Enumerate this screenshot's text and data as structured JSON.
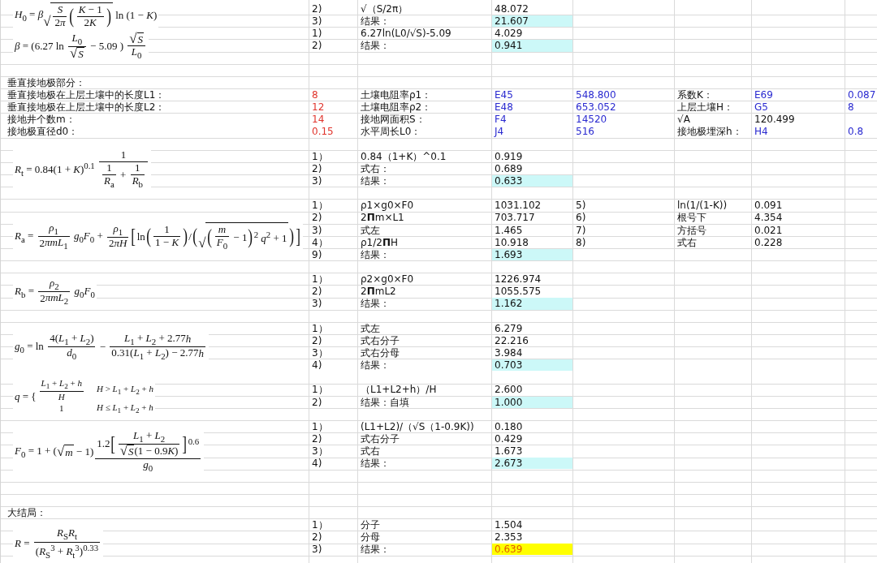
{
  "sheet": [
    {
      "formula": [
        "*H*$_{0}$ = *β*",
        {
          "root": "√",
          "body": [
            {
              "frac": [
                "*S*",
                [
                  "2",
                  "*π*"
                ]
              ]
            },
            {
              "big": "("
            },
            {
              "frac": [
                "*K* − 1",
                [
                  "2",
                  "*K*"
                ]
              ]
            },
            {
              "big": ")"
            }
          ]
        },
        " ln (1 − *K*)"
      ],
      "rows": [
        {
          "cells": [
            {},
            {
              "text": "2)"
            },
            {
              "text": "√（S/2π）"
            },
            {
              "text": "48.072"
            }
          ]
        },
        {
          "cells": [
            {},
            {
              "text": "3)"
            },
            {
              "text": "结果："
            },
            {
              "text": "21.607",
              "kind": "result"
            }
          ]
        }
      ]
    },
    {
      "formula": [
        "*β* = (6.27 ln ",
        {
          "frac": [
            "*L*$_{0}$",
            [
              {
                "root": "√",
                "body": "*S*"
              }
            ]
          ]
        },
        " − 5.09 ) ",
        {
          "frac": [
            [
              {
                "root": "√",
                "body": "*S*"
              }
            ],
            "*L*$_{0}$"
          ]
        }
      ],
      "rows": [
        {
          "cells": [
            {},
            {
              "text": "1)"
            },
            {
              "text": "6.27ln(L0/√S)-5.09"
            },
            {
              "text": "4.029"
            }
          ]
        },
        {
          "cells": [
            {},
            {
              "text": "2)"
            },
            {
              "text": "结果："
            },
            {
              "text": "0.941",
              "kind": "result"
            }
          ]
        },
        {}
      ]
    },
    {
      "rows": [
        {},
        {
          "cells": [
            {
              "text": "垂直接地极部分："
            }
          ]
        },
        {
          "cells": [
            {
              "text": "垂直接地极在上层土壤中的长度L1："
            },
            {
              "text": "8",
              "color": "#e0342c"
            },
            {
              "text": "土壤电阻率ρ1："
            },
            {
              "text": "E45",
              "color": "#2a2ad0"
            },
            {
              "text": "548.800",
              "color": "#2a2ad0"
            },
            {
              "text": "系数K："
            },
            {
              "text": "E69",
              "color": "#2a2ad0"
            },
            {
              "text": "0.087",
              "color": "#2a2ad0"
            }
          ]
        },
        {
          "cells": [
            {
              "text": "垂直接地极在上层土壤中的长度L2："
            },
            {
              "text": "12",
              "color": "#e0342c"
            },
            {
              "text": "土壤电阻率ρ2："
            },
            {
              "text": "E48",
              "color": "#2a2ad0"
            },
            {
              "text": "653.052",
              "color": "#2a2ad0"
            },
            {
              "text": "上层土壤H："
            },
            {
              "text": "G5",
              "color": "#2a2ad0"
            },
            {
              "text": "8",
              "color": "#2a2ad0"
            }
          ]
        },
        {
          "cells": [
            {
              "text": "接地井个数m："
            },
            {
              "text": "14",
              "color": "#e0342c"
            },
            {
              "text": "接地网面积S："
            },
            {
              "text": "F4",
              "color": "#2a2ad0"
            },
            {
              "text": "14520",
              "color": "#2a2ad0"
            },
            {
              "text": "√A"
            },
            {
              "text": "120.499"
            }
          ]
        },
        {
          "cells": [
            {
              "text": "接地极直径d0："
            },
            {
              "text": "0.15",
              "color": "#e0342c"
            },
            {
              "text": "水平周长L0："
            },
            {
              "text": "J4",
              "color": "#2a2ad0"
            },
            {
              "text": "516",
              "color": "#2a2ad0"
            },
            {
              "text": "接地极埋深h："
            },
            {
              "text": "H4",
              "color": "#2a2ad0"
            },
            {
              "text": "0.8",
              "color": "#2a2ad0"
            }
          ]
        }
      ]
    },
    {
      "formula": [
        "*R*$_{t}$ = 0.84(1 + *K*)$^{0.1}$ ",
        {
          "frac": [
            "1",
            [
              {
                "frac": [
                  "1",
                  "*R*$_{a}$"
                ]
              },
              " + ",
              {
                "frac": [
                  "1",
                  "*R*$_{b}$"
                ]
              }
            ]
          ]
        }
      ],
      "rows": [
        {},
        {
          "cells": [
            {},
            {
              "text": "1）"
            },
            {
              "text": "0.84（1+K）^0.1"
            },
            {
              "text": "0.919"
            }
          ]
        },
        {
          "cells": [
            {},
            {
              "text": "2)"
            },
            {
              "text": "式右："
            },
            {
              "text": "0.689"
            }
          ]
        },
        {
          "cells": [
            {},
            {
              "text": "3)"
            },
            {
              "text": "结果："
            },
            {
              "text": "0.633",
              "kind": "result"
            }
          ]
        },
        {}
      ]
    },
    {
      "formula": [
        "*R*$_{a}$ = ",
        {
          "frac": [
            "*ρ*$_{1}$",
            [
              "2",
              "*πmL*$_{1}$"
            ]
          ]
        },
        " *g*$_{0}$*F*$_{0}$ + ",
        {
          "frac": [
            "*ρ*$_{1}$",
            [
              "2",
              "*πH*"
            ]
          ]
        },
        {
          "big": "["
        },
        "ln",
        {
          "big": "("
        },
        {
          "frac": [
            "1",
            "1 − *K*"
          ]
        },
        {
          "big": ")"
        },
        "/",
        {
          "big": "("
        },
        {
          "root": "√",
          "body": [
            {
              "big": "("
            },
            {
              "frac": [
                "*m*",
                "*F*$_{0}$"
              ]
            },
            " − 1",
            {
              "big": ")"
            },
            "$^{2}$ *q*$^{2}$ + 1"
          ]
        },
        {
          "big": ")"
        },
        {
          "big": "]"
        }
      ],
      "rows": [
        {
          "cells": [
            {},
            {
              "text": "1）"
            },
            {
              "text": "ρ1×g0×F0"
            },
            {
              "text": "1031.102"
            },
            {
              "text": "5)"
            },
            {
              "text": "ln(1/(1-K))"
            },
            {
              "text": "0.091"
            }
          ]
        },
        {
          "cells": [
            {},
            {
              "text": "2)"
            },
            {
              "text": "2**Π**m×L1"
            },
            {
              "text": "703.717"
            },
            {
              "text": "6)"
            },
            {
              "text": "根号下"
            },
            {
              "text": "4.354"
            }
          ]
        },
        {
          "cells": [
            {},
            {
              "text": "3)"
            },
            {
              "text": "式左"
            },
            {
              "text": "1.465"
            },
            {
              "text": "7)"
            },
            {
              "text": "方括号"
            },
            {
              "text": "0.021"
            }
          ]
        },
        {
          "cells": [
            {},
            {
              "text": "4）"
            },
            {
              "text": "ρ1/2**Π**H"
            },
            {
              "text": "10.918"
            },
            {
              "text": "8)"
            },
            {
              "text": "式右"
            },
            {
              "text": "0.228"
            }
          ]
        },
        {
          "cells": [
            {},
            {
              "text": "9)"
            },
            {
              "text": "结果："
            },
            {
              "text": "1.693",
              "kind": "result"
            }
          ]
        },
        {}
      ]
    },
    {
      "formula": [
        "*R*$_{b}$ = ",
        {
          "frac": [
            "*ρ*$_{2}$",
            [
              "2",
              "*πmL*$_{2}$"
            ]
          ]
        },
        " *g*$_{0}$*F*$_{0}$"
      ],
      "rows": [
        {
          "cells": [
            {},
            {
              "text": "1）"
            },
            {
              "text": "ρ2×g0×F0"
            },
            {
              "text": "1226.974"
            }
          ]
        },
        {
          "cells": [
            {},
            {
              "text": "2)"
            },
            {
              "text": "2**Π**mL2"
            },
            {
              "text": "1055.575"
            }
          ]
        },
        {
          "cells": [
            {},
            {
              "text": "3)"
            },
            {
              "text": "结果："
            },
            {
              "text": "1.162",
              "kind": "result"
            }
          ]
        }
      ]
    },
    {
      "rows": [
        {}
      ]
    },
    {
      "formula": [
        "*g*$_{0}$ = ln ",
        {
          "frac": [
            "4(*L*$_{1}$ + *L*$_{2}$)",
            "*d*$_{0}$"
          ]
        },
        " − ",
        {
          "frac": [
            [
              "*L*$_{1}$ + *L*$_{2}$ + 2.77",
              "*h*"
            ],
            [
              "0.31(*L*$_{1}$ + *L*$_{2}$) − 2.77",
              "*h*"
            ]
          ]
        }
      ],
      "rows": [
        {
          "cells": [
            {},
            {
              "text": "1）"
            },
            {
              "text": "式左"
            },
            {
              "text": "6.279"
            }
          ]
        },
        {
          "cells": [
            {},
            {
              "text": "2)"
            },
            {
              "text": "式右分子"
            },
            {
              "text": "22.216"
            }
          ]
        },
        {
          "cells": [
            {},
            {
              "text": "3）"
            },
            {
              "text": "式右分母"
            },
            {
              "text": "3.984"
            }
          ]
        },
        {
          "cells": [
            {},
            {
              "text": "4)"
            },
            {
              "text": "结果："
            },
            {
              "text": "0.703",
              "kind": "result"
            }
          ]
        }
      ]
    },
    {
      "formula": [
        "*q* = {",
        {
          "cases": [
            [
              [
                {
                  "frac": [
                    "*L*$_{1}$ + *L*$_{2}$ + *h*",
                    "*H*"
                  ]
                }
              ],
              "*H* > *L*$_{1}$ + *L*$_{2}$ + *h*"
            ],
            [
              "1",
              "*H* ≤ *L*$_{1}$ + *L*$_{2}$ + *h*"
            ]
          ]
        }
      ],
      "rows": [
        {},
        {
          "cells": [
            {},
            {
              "text": "1）"
            },
            {
              "text": "（L1+L2+h）/H"
            },
            {
              "text": "2.600"
            }
          ]
        },
        {
          "cells": [
            {},
            {
              "text": "2)"
            },
            {
              "text": "结果：自填"
            },
            {
              "text": "1.000",
              "kind": "result"
            }
          ]
        },
        {}
      ]
    },
    {
      "formula": [
        "*F*$_{0}$ = 1 + (",
        {
          "root": "√",
          "body": "*m*"
        },
        " − 1)",
        {
          "frac": [
            [
              "1.2",
              {
                "big": "["
              },
              {
                "frac": [
                  "*L*$_{1}$ + *L*$_{2}$",
                  [
                    {
                      "root": "√",
                      "body": "*S*"
                    },
                    "(1 − 0.9",
                    "*K*",
                    ")"
                  ]
                ]
              },
              {
                "big": "]"
              },
              "$^{0.6}$"
            ],
            "*g*$_{0}$"
          ]
        }
      ],
      "rows": [
        {
          "cells": [
            {},
            {
              "text": "1）"
            },
            {
              "text": "(L1+L2)/（√S（1-0.9K))"
            },
            {
              "text": "0.180"
            }
          ]
        },
        {
          "cells": [
            {},
            {
              "text": "2)"
            },
            {
              "text": "式右分子"
            },
            {
              "text": "0.429"
            }
          ]
        },
        {
          "cells": [
            {},
            {
              "text": "3）"
            },
            {
              "text": "式右"
            },
            {
              "text": "1.673"
            }
          ]
        },
        {
          "cells": [
            {},
            {
              "text": "4)"
            },
            {
              "text": "结果："
            },
            {
              "text": "2.673",
              "kind": "result"
            }
          ]
        },
        {}
      ]
    },
    {
      "rows": [
        {},
        {},
        {
          "cells": [
            {
              "text": "大结局："
            }
          ]
        }
      ]
    },
    {
      "formula": [
        "*R* = ",
        {
          "frac": [
            "*R*$_{S}$*R*$_{t}$",
            "(*R*$_{S}$$^{3}$ + *R*$_{t}$$^{3}$)$^{0.33}$"
          ]
        }
      ],
      "rows": [
        {
          "cells": [
            {},
            {
              "text": "1）"
            },
            {
              "text": "分子"
            },
            {
              "text": "1.504"
            }
          ]
        },
        {
          "cells": [
            {},
            {
              "text": "2)"
            },
            {
              "text": "分母"
            },
            {
              "text": "2.353"
            }
          ]
        },
        {
          "cells": [
            {},
            {
              "text": "3)"
            },
            {
              "text": "结果："
            },
            {
              "text": "0.639",
              "kind": "final"
            }
          ]
        },
        {}
      ]
    }
  ]
}
